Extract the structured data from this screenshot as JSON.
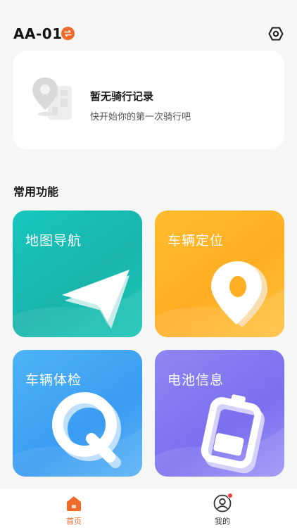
{
  "header": {
    "device_name": "AA-01"
  },
  "record_card": {
    "title": "暂无骑行记录",
    "subtitle": "快开始你的第一次骑行吧"
  },
  "section": {
    "title": "常用功能"
  },
  "features": [
    {
      "label": "地图导航",
      "icon": "navigation-arrow-icon",
      "color": "#19b9b0"
    },
    {
      "label": "车辆定位",
      "icon": "location-pin-icon",
      "color": "#ffb024"
    },
    {
      "label": "车辆体检",
      "icon": "magnifier-q-icon",
      "color": "#3d9ff3"
    },
    {
      "label": "电池信息",
      "icon": "battery-icon",
      "color": "#7e72f1"
    }
  ],
  "bottom_nav": {
    "home_label": "首页",
    "me_label": "我的"
  },
  "colors": {
    "accent": "#f06a2a",
    "notification_dot": "#f24040"
  }
}
